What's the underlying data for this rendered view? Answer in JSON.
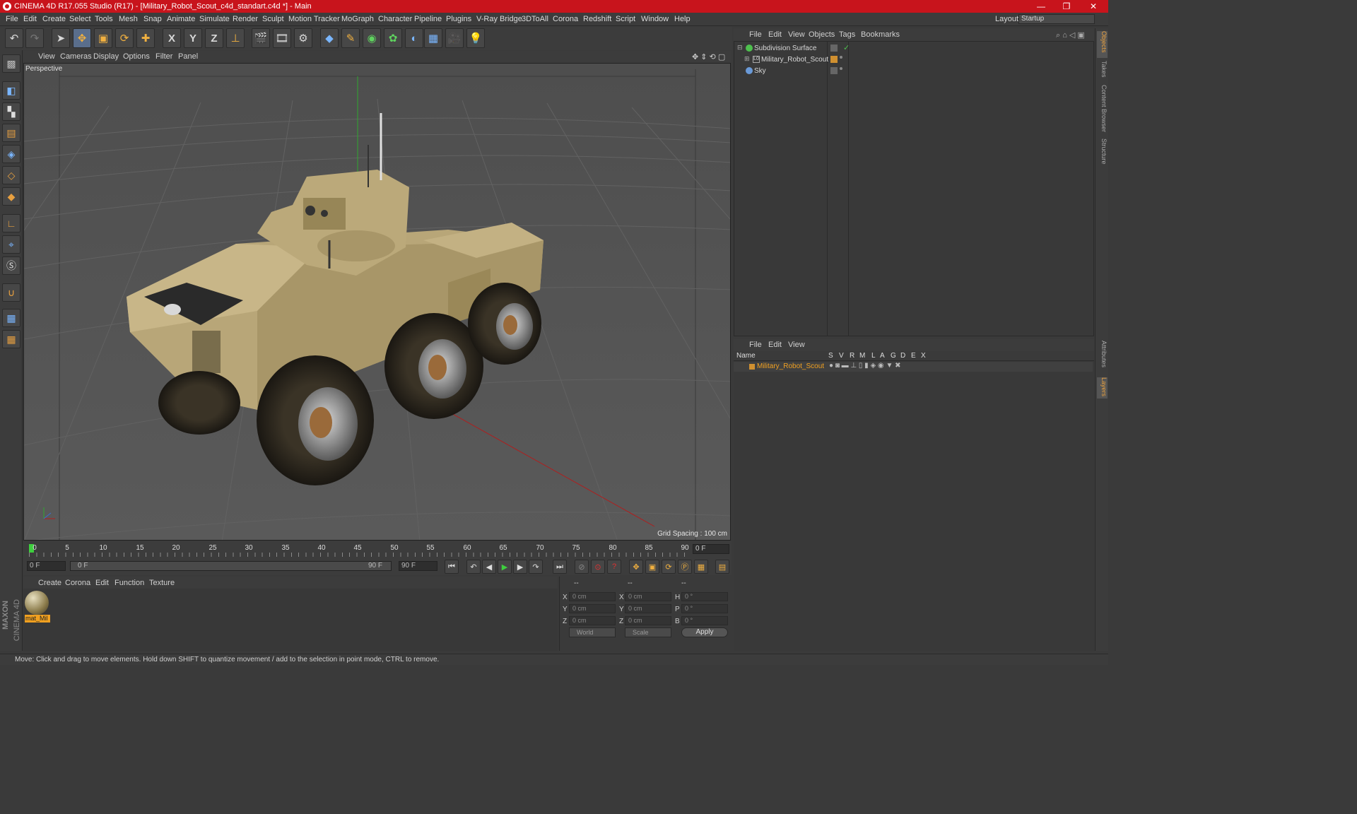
{
  "titlebar": {
    "title": "CINEMA 4D R17.055 Studio (R17) - [Military_Robot_Scout_c4d_standart.c4d *] - Main",
    "minimize": "—",
    "restore": "❐",
    "close": "✕"
  },
  "menubar": {
    "items": [
      "File",
      "Edit",
      "Create",
      "Select",
      "Tools",
      "Mesh",
      "Snap",
      "Animate",
      "Simulate",
      "Render",
      "Sculpt",
      "Motion Tracker",
      "MoGraph",
      "Character",
      "Pipeline",
      "Plugins",
      "V-Ray Bridge",
      "3DToAll",
      "Corona",
      "Redshift",
      "Script",
      "Window",
      "Help"
    ],
    "layout_label": "Layout:",
    "layout_value": "Startup"
  },
  "toolbar": {
    "icons": [
      "undo-icon",
      "redo-icon",
      "pointer-icon",
      "move-icon",
      "scale-icon",
      "rotate-icon",
      "live-select-icon",
      "x-axis-icon",
      "y-axis-icon",
      "z-axis-icon",
      "world-coord-icon",
      "render-view-icon",
      "render-picture-viewer-icon",
      "edit-render-settings-icon",
      "cube-icon",
      "pen-icon",
      "subdivision-icon",
      "cloner-icon",
      "deformer-icon",
      "floor-icon",
      "camera-icon",
      "light-icon"
    ],
    "x_label": "X",
    "y_label": "Y",
    "z_label": "Z"
  },
  "viewport": {
    "menu": [
      "View",
      "Cameras",
      "Display",
      "Options",
      "Filter",
      "Panel"
    ],
    "label": "Perspective",
    "grid_spacing": "Grid Spacing : 100 cm"
  },
  "timeline": {
    "ticks": [
      "0",
      "5",
      "10",
      "15",
      "20",
      "25",
      "30",
      "35",
      "40",
      "45",
      "50",
      "55",
      "60",
      "65",
      "70",
      "75",
      "80",
      "85",
      "90"
    ],
    "current_frame": "0 F"
  },
  "transport": {
    "start_field": "0 F",
    "range_start": "0 F",
    "range_end": "90 F",
    "end_field": "90 F"
  },
  "material_manager": {
    "menu": [
      "Create",
      "Corona",
      "Edit",
      "Function",
      "Texture"
    ],
    "material_name": "mat_Mil"
  },
  "coordinates": {
    "header": [
      "--",
      "--",
      "--"
    ],
    "rows": [
      {
        "axis": "X",
        "pos": "0 cm",
        "axis2": "X",
        "size": "0 cm",
        "rot_axis": "H",
        "rot": "0 °"
      },
      {
        "axis": "Y",
        "pos": "0 cm",
        "axis2": "Y",
        "size": "0 cm",
        "rot_axis": "P",
        "rot": "0 °"
      },
      {
        "axis": "Z",
        "pos": "0 cm",
        "axis2": "Z",
        "size": "0 cm",
        "rot_axis": "B",
        "rot": "0 °"
      }
    ],
    "coord_system": "World",
    "mode": "Scale",
    "apply": "Apply"
  },
  "object_manager": {
    "menu": [
      "File",
      "Edit",
      "View",
      "Objects",
      "Tags",
      "Bookmarks"
    ],
    "objects": [
      "Subdivision Surface",
      "Military_Robot_Scout",
      "Sky"
    ]
  },
  "layer_manager": {
    "menu": [
      "File",
      "Edit",
      "View"
    ],
    "columns": [
      "Name",
      "S",
      "V",
      "R",
      "M",
      "L",
      "A",
      "G",
      "D",
      "E",
      "X"
    ],
    "layers": [
      "Military_Robot_Scout"
    ]
  },
  "right_tabs": [
    "Objects",
    "Takes",
    "Content Browser",
    "Structure",
    "Attributes",
    "Layers"
  ],
  "statusbar": {
    "text": "Move: Click and drag to move elements. Hold down SHIFT to quantize movement / add to the selection in point mode, CTRL to remove."
  },
  "brand": {
    "maxon": "MAXON",
    "cinema": "CINEMA 4D"
  },
  "colors": {
    "titlebar": "#c8141c",
    "accent": "#f0a020",
    "vehicle": "#b8a678"
  }
}
